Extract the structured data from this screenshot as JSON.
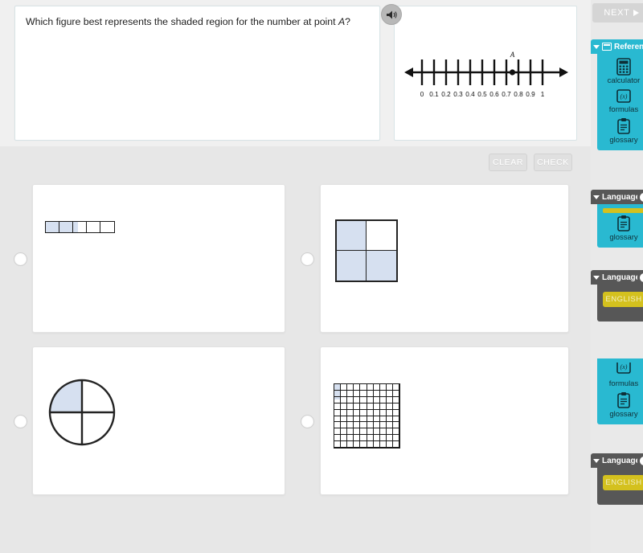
{
  "question": {
    "prompt_before": "Which figure best represents the shaded region for the number at point ",
    "prompt_italic": "A",
    "prompt_after": "?",
    "full_text": "Which figure best represents the shaded region for the number at point A?"
  },
  "audio": {
    "icon": "speaker-icon"
  },
  "actions": {
    "clear_label": "CLEAR",
    "check_label": "CHECK"
  },
  "stimulus": {
    "point_label": "A",
    "point_value": 0.75
  },
  "chart_data": {
    "type": "line",
    "title": "",
    "xlabel": "",
    "ylabel": "",
    "xlim": [
      0,
      1
    ],
    "grid": false,
    "tick_labels": [
      "0",
      "0.1",
      "0.2",
      "0.3",
      "0.4",
      "0.5",
      "0.6",
      "0.7",
      "0.8",
      "0.9",
      "1"
    ],
    "tick_values": [
      0,
      0.1,
      0.2,
      0.3,
      0.4,
      0.5,
      0.6,
      0.7,
      0.8,
      0.9,
      1
    ],
    "annotations": [
      {
        "label": "A",
        "x": 0.75,
        "marker": "filled-dot"
      }
    ],
    "arrows": [
      "left",
      "right"
    ]
  },
  "options": [
    {
      "id": "option-a",
      "figure": "bar-model",
      "selected": false,
      "cells": 5,
      "shaded_cells": [
        true,
        true,
        "partial",
        false,
        false
      ]
    },
    {
      "id": "option-b",
      "figure": "square-2x2",
      "selected": false,
      "cells": 4,
      "shaded_cells": [
        true,
        false,
        true,
        true
      ]
    },
    {
      "id": "option-c",
      "figure": "circle-quarters",
      "selected": false,
      "cells": 4,
      "shaded_cells": [
        true,
        false,
        false,
        false
      ]
    },
    {
      "id": "option-d",
      "figure": "grid-10x10",
      "rows": 10,
      "columns": 10,
      "selected": false,
      "shaded_description": "first column rows 1-2 fully shaded, row 3 partially shaded"
    }
  ],
  "colors": {
    "shade": "#d6e0f0",
    "stroke": "#1b1b1b",
    "teal": "#29b9d1",
    "dark_gray": "#575757",
    "yellow": "#d4c11e",
    "page_bg": "#e7e7e7"
  },
  "rail": {
    "next_label": "NEXT",
    "panels": [
      {
        "id": "reference-panel-1",
        "title": "Reference",
        "style": "teal",
        "tools": [
          {
            "label": "calculator",
            "icon": "calculator-icon"
          },
          {
            "label": "formulas",
            "icon": "formulas-icon"
          },
          {
            "label": "glossary",
            "icon": "glossary-clipboard-icon"
          }
        ]
      },
      {
        "id": "language-panel-1",
        "title": "Language",
        "style": "gray",
        "info": "i",
        "tools": [
          {
            "label": "glossary",
            "icon": "glossary-clipboard-icon"
          }
        ]
      },
      {
        "id": "language-panel-2",
        "title": "Language",
        "style": "gray",
        "info": "i",
        "language_button": "ENGLISH"
      },
      {
        "id": "reference-panel-2",
        "title": "",
        "style": "teal",
        "tools": [
          {
            "label": "formulas",
            "icon": "formulas-icon"
          },
          {
            "label": "glossary",
            "icon": "glossary-clipboard-icon"
          }
        ]
      },
      {
        "id": "language-panel-3",
        "title": "Language",
        "style": "gray",
        "info": "i",
        "language_button": "ENGLISH"
      }
    ]
  }
}
